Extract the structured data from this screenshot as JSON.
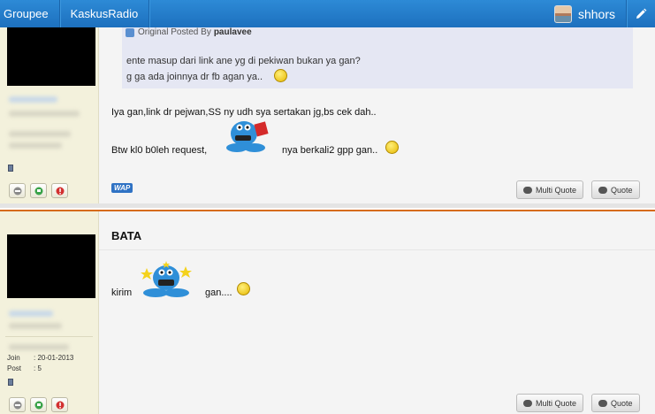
{
  "topbar": {
    "nav": [
      "Groupee",
      "KaskusRadio"
    ],
    "username": "shhors"
  },
  "posts": [
    {
      "quote": {
        "header": "Original Posted By",
        "author": "paulavee",
        "lines": [
          "ente masup dari link ane yg di pekiwan bukan ya gan?",
          "g ga ada joinnya dr fb agan ya.."
        ]
      },
      "lines": [
        "Iya gan,link dr pejwan,SS ny udh sya sertakan jg,bs cek dah..",
        "Btw kl0 b0leh request,",
        "nya berkali2 gpp gan.."
      ],
      "wap": "WAP",
      "multi_quote": "Multi Quote",
      "quote_btn": "Quote"
    },
    {
      "title": "BATA",
      "user": {
        "join_label": "Join",
        "join_value": ": 20-01-2013",
        "post_label": "Post",
        "post_value": ": 5"
      },
      "lines": [
        "kirim",
        "gan...."
      ],
      "multi_quote": "Multi Quote",
      "quote_btn": "Quote"
    }
  ],
  "colors": {
    "topbar": "#1d70be",
    "accent_border": "#d66b1c",
    "userinfo_bg": "#f3f1dc"
  }
}
